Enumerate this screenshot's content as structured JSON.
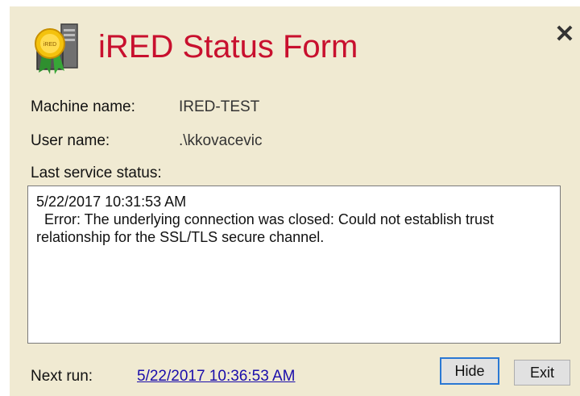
{
  "window": {
    "title": "iRED Status Form",
    "close_symbol": "✕",
    "icon": "certificate-server-icon",
    "icon_badge_text": "iRED"
  },
  "info": {
    "machine_label": "Machine name:",
    "machine_value": "IRED-TEST",
    "user_label": "User name:",
    "user_value": ".\\kkovacevic",
    "status_label": "Last service status:"
  },
  "status": {
    "timestamp": "5/22/2017 10:31:53 AM",
    "error": "Error: The underlying connection was closed: Could not establish trust relationship for the SSL/TLS secure channel."
  },
  "footer": {
    "next_run_label": "Next run:",
    "next_run_value": "5/22/2017 10:36:53 AM",
    "hide_label": "Hide",
    "exit_label": "Exit"
  },
  "colors": {
    "title": "#c8102e",
    "background": "#f0ead2",
    "link": "#1a0dab",
    "focus_border": "#2a78d4"
  }
}
